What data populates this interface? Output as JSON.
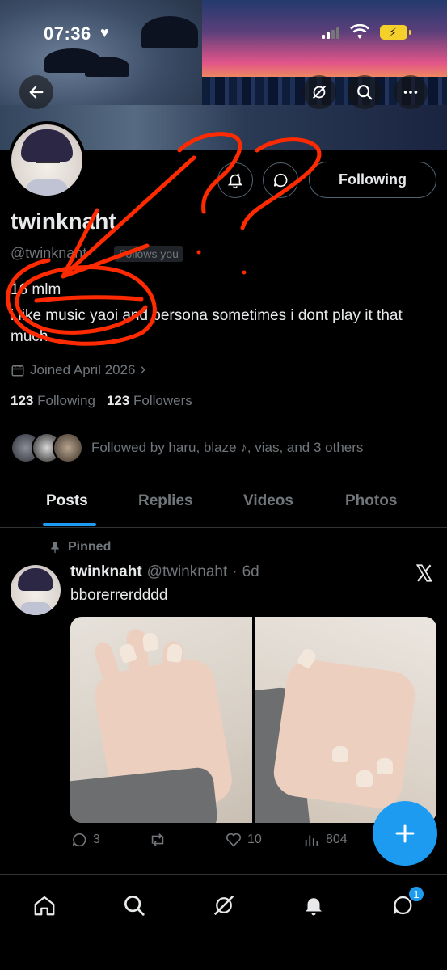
{
  "status_bar": {
    "time": "07:36",
    "heart": "♥"
  },
  "profile": {
    "display_name": "twinknaht",
    "handle": "@twinknaht",
    "follows_you": "Follows you",
    "bio_line1": "16 mlm",
    "bio_line2": "i like music yaoi and persona sometimes i dont play it that much",
    "joined": "Joined April 2026",
    "following_count": "123",
    "following_label": "Following",
    "followers_count": "123",
    "followers_label": "Followers",
    "followed_by": "Followed by haru, blaze ♪, vias, and 3 others",
    "follow_button": "Following"
  },
  "tabs": [
    {
      "label": "Posts",
      "active": true
    },
    {
      "label": "Replies",
      "active": false
    },
    {
      "label": "Videos",
      "active": false
    },
    {
      "label": "Photos",
      "active": false
    }
  ],
  "tweet": {
    "pinned_label": "Pinned",
    "name": "twinknaht",
    "handle": "@twinknaht",
    "separator": "·",
    "age": "6d",
    "text": "bborerrerdddd",
    "replies": "3",
    "reposts": "",
    "likes": "10",
    "views": "804"
  },
  "nav": {
    "notification_badge": "1",
    "icons": [
      "home-icon",
      "search-icon",
      "grok-icon",
      "notifications-icon",
      "messages-icon"
    ]
  },
  "colors": {
    "accent": "#1d9bf0",
    "text_primary": "#e7e9ea",
    "text_secondary": "#71767b",
    "annotation_red": "#ff2a00"
  }
}
